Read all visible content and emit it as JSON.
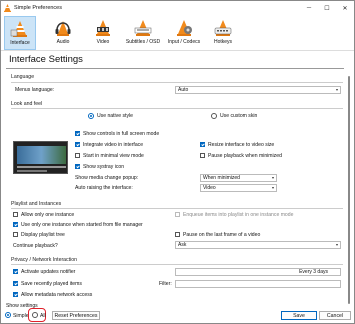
{
  "window": {
    "title": "Simple Preferences",
    "minimize": "─",
    "maximize": "☐",
    "close": "✕"
  },
  "toolbar": {
    "items": [
      {
        "label": "Interface",
        "selected": true
      },
      {
        "label": "Audio"
      },
      {
        "label": "Video"
      },
      {
        "label": "Subtitles / OSD"
      },
      {
        "label": "Input / Codecs"
      },
      {
        "label": "Hotkeys"
      }
    ]
  },
  "header": "Interface Settings",
  "language": {
    "group": "Language",
    "menus_label": "Menus language:",
    "menus_value": "Auto"
  },
  "look": {
    "group": "Look and feel",
    "native_style": "Use native style",
    "custom_skin": "Use custom skin",
    "show_controls": "Show controls in full screen mode",
    "integrate_video": "Integrate video in interface",
    "resize_interface": "Resize interface to video size",
    "minimal_view": "Start in minimal view mode",
    "pause_minimized": "Pause playback when minimized",
    "systray": "Show systray icon",
    "media_popup_label": "Show media change popup:",
    "media_popup_value": "When minimized",
    "auto_raise_label": "Auto raising the interface:",
    "auto_raise_value": "Video"
  },
  "playlist": {
    "group": "Playlist and Instances",
    "one_instance": "Allow only one instance",
    "enqueue": "Enqueue items into playlist in one instance mode",
    "file_manager": "Use only one instance when started from file manager",
    "playlist_tree": "Display playlist tree",
    "pause_last": "Pause on the last frame of a video",
    "continue_label": "Continue playback?",
    "continue_value": "Ask"
  },
  "privacy": {
    "group": "Privacy / Network Interaction",
    "updates": "Activate updates notifier",
    "updates_value": "Every 3 days",
    "recent": "Save recently played items",
    "filter_label": "Filter:",
    "metadata": "Allow metadata network access"
  },
  "footer": {
    "show_settings": "Show settings",
    "simple": "Simple",
    "all": "All",
    "reset": "Reset Preferences",
    "save": "Save",
    "cancel": "Cancel"
  },
  "colors": {
    "accent": "#0067c0",
    "selected_tab": "#cce4f7",
    "highlight_circle": "#e0202a"
  }
}
